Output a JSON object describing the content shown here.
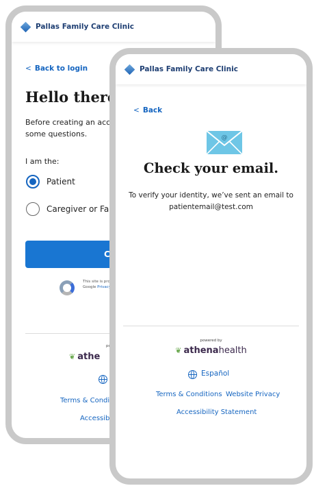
{
  "clinic_name": "Pallas Family Care Clinic",
  "screen_signup": {
    "back_label": "Back to login",
    "heading": "Hello there.",
    "intro_line1": "Before creating an accou",
    "intro_line2": "some questions.",
    "role_label": "I am the:",
    "options": [
      {
        "label": "Patient",
        "selected": true
      },
      {
        "label": "Caregiver or Family",
        "selected": false
      }
    ],
    "button_label": "Co",
    "recaptcha_line1": "This site is prot",
    "recaptcha_line2_prefix": "Google ",
    "recaptcha_line2_link": "Privacy",
    "powered_by": "po",
    "athena_brand": "athe",
    "terms_link": "Terms & Conditi",
    "accessibility_link": "Accessibil"
  },
  "screen_check_email": {
    "back_label": "Back",
    "heading": "Check your email.",
    "message_line1": "To verify your identity, we’ve sent an email to",
    "email": "patientemail@test.com",
    "powered_by": "powered by",
    "athena_brand_bold": "athena",
    "athena_brand_light": "health",
    "language_label": "Español",
    "terms_link": "Terms & Conditions",
    "privacy_link": "Website Privacy",
    "accessibility_link": "Accessibility Statement"
  },
  "colors": {
    "accent": "#1976d2",
    "link": "#1565c0",
    "frame": "#c9c9c9",
    "mail_icon": "#6ec6e6"
  },
  "icons": {
    "logo": "diamond-logo-icon",
    "back": "chevron-left-icon",
    "mail": "envelope-at-icon",
    "language": "globe-icon",
    "recaptcha": "recaptcha-icon",
    "athena": "leaf-icon"
  }
}
